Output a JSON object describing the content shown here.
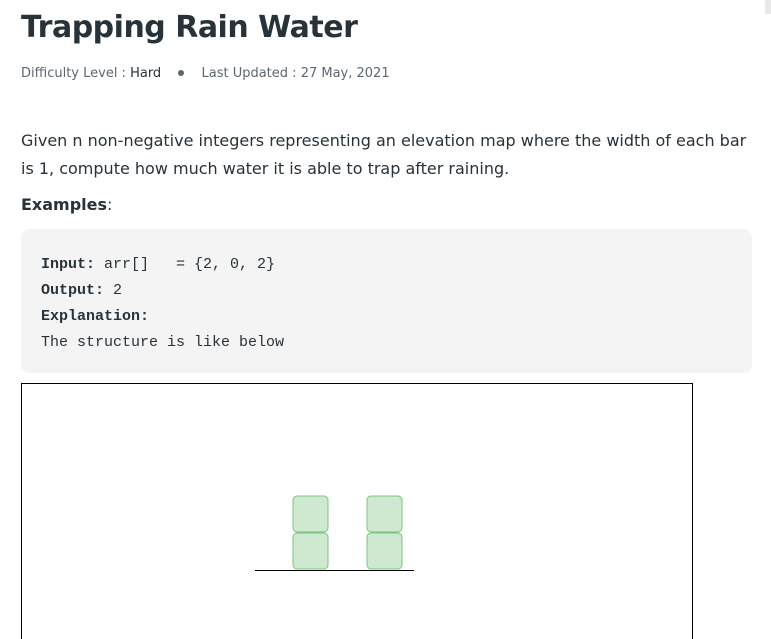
{
  "article": {
    "title": "Trapping Rain Water",
    "meta": {
      "difficulty_label": "Difficulty Level : ",
      "difficulty_value": "Hard",
      "updated_label": "Last Updated : ",
      "updated_value": "27 May, 2021"
    },
    "intro": "Given n non-negative integers representing an elevation map where the width of each bar is 1, compute how much water it is able to trap after raining.",
    "examples_heading": "Examples",
    "examples_colon": ":",
    "example": {
      "input_label": "Input:",
      "input_value": " arr[]   = {2, 0, 2}",
      "output_label": "Output:",
      "output_value": " 2",
      "explanation_label": "Explanation:",
      "explanation_text": "The structure is like below"
    },
    "figure": {
      "elevation": [
        2,
        0,
        2
      ],
      "block_fill": "#cfe8d0",
      "block_stroke": "#7cc47f",
      "ground_color": "#000000"
    }
  },
  "colors": {
    "text": "#273239",
    "muted": "#5b6770",
    "code_bg": "#f4f4f4"
  }
}
